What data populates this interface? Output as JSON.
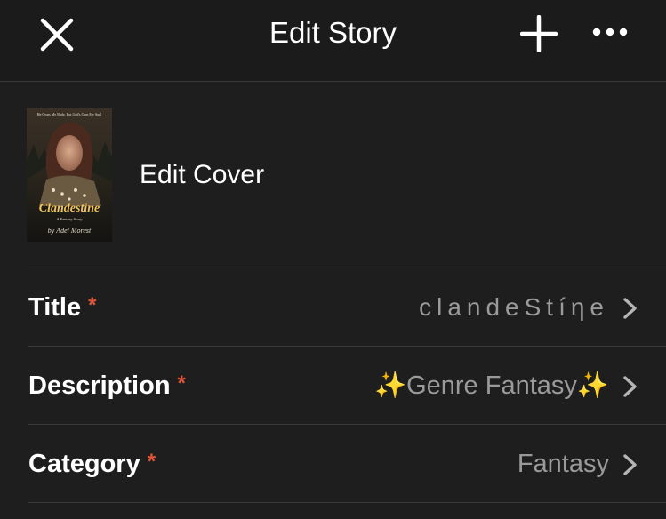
{
  "header": {
    "title": "Edit Story",
    "close_icon": "close-icon",
    "add_icon": "plus-icon",
    "more_icon": "more-horizontal-icon"
  },
  "cover": {
    "label": "Edit Cover",
    "image": {
      "tagline": "He Owns My Body, But God's Own My Soul",
      "book_title": "Clandestine",
      "subtitle": "A Fantasy Story",
      "author": "by Adel Morest"
    }
  },
  "fields": [
    {
      "label": "Title",
      "required": "*",
      "value": "clandeStíηe"
    },
    {
      "label": "Description",
      "required": "*",
      "value": "✨Genre Fantasy✨"
    },
    {
      "label": "Category",
      "required": "*",
      "value": "Fantasy"
    }
  ],
  "colors": {
    "background": "#1e1e1e",
    "header_background": "#1b1b1b",
    "divider": "#3a3a3a",
    "required_asterisk": "#e0553a",
    "value_text": "#9a9a9a"
  }
}
